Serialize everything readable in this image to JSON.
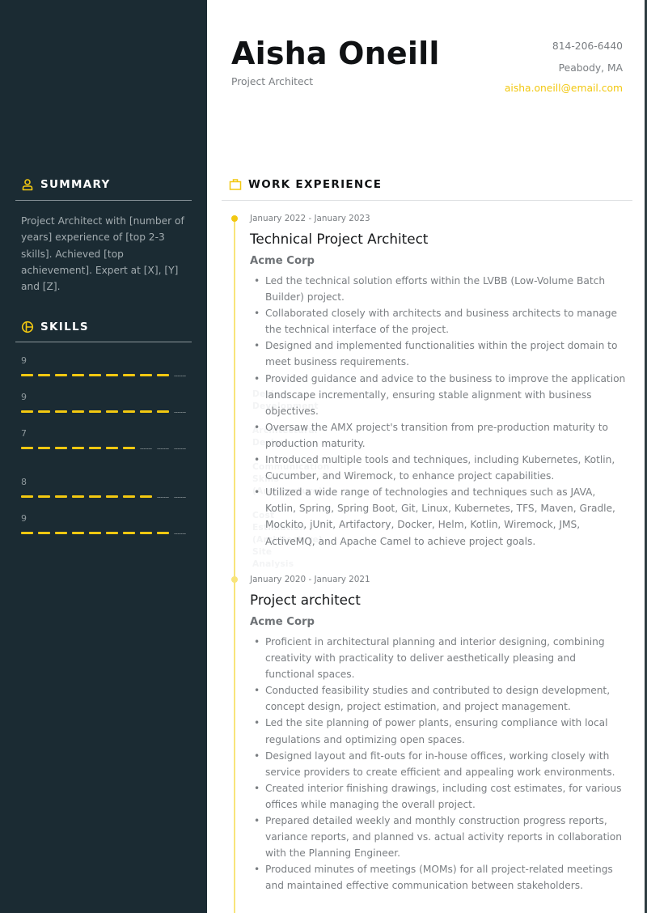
{
  "header": {
    "name": "Aisha Oneill",
    "title": "Project Architect",
    "phone": "814-206-6440",
    "location": "Peabody, MA",
    "email": "aisha.oneill@email.com"
  },
  "colors": {
    "sidebar_bg": "#1b2b33",
    "accent": "#f2c811",
    "accent_light": "#f8e47a"
  },
  "sidebar": {
    "summary": {
      "icon": "person-icon",
      "title": "SUMMARY",
      "text": "Project Architect with [number of years] experience of [top 2-3 skills]. Achieved [top achievement]. Expert at [X], [Y] and [Z]."
    },
    "skills": {
      "icon": "pie-chart-icon",
      "title": "SKILLS",
      "max_score": 10,
      "items": [
        {
          "name": "Design Development",
          "score": 9
        },
        {
          "name": "Architectural Design",
          "score": 9
        },
        {
          "name": "Communication Skills (Architecture)",
          "score": 7
        },
        {
          "name": "Cost Estimation (Architecture)",
          "score": 8
        },
        {
          "name": "Site Analysis",
          "score": 9
        }
      ]
    }
  },
  "experience": {
    "icon": "briefcase-icon",
    "title": "WORK EXPERIENCE",
    "jobs": [
      {
        "dates": "January 2022 - January 2023",
        "role": "Technical Project Architect",
        "company": "Acme Corp",
        "bullets": [
          "Led the technical solution efforts within the LVBB (Low-Volume Batch Builder) project.",
          "Collaborated closely with architects and business architects to manage the technical interface of the project.",
          "Designed and implemented functionalities within the project domain to meet business requirements.",
          "Provided guidance and advice to the business to improve the application landscape incrementally, ensuring stable alignment with business objectives.",
          "Oversaw the AMX project's transition from pre-production maturity to production maturity.",
          "Introduced multiple tools and techniques, including Kubernetes, Kotlin, Cucumber, and Wiremock, to enhance project capabilities.",
          "Utilized a wide range of technologies and techniques such as JAVA, Kotlin, Spring, Spring Boot, Git, Linux, Kubernetes, TFS, Maven, Gradle, Mockito, jUnit, Artifactory, Docker, Helm, Kotlin, Wiremock, JMS, ActiveMQ, and Apache Camel to achieve project goals."
        ]
      },
      {
        "dates": "January 2020 - January 2021",
        "role": "Project architect",
        "company": "Acme Corp",
        "bullets": [
          "Proficient in architectural planning and interior designing, combining creativity with practicality to deliver aesthetically pleasing and functional spaces.",
          "Conducted feasibility studies and contributed to design development, concept design, project estimation, and project management.",
          "Led the site planning of power plants, ensuring compliance with local regulations and optimizing open spaces.",
          "Designed layout and fit-outs for in-house offices, working closely with service providers to create efficient and appealing work environments.",
          "Created interior finishing drawings, including cost estimates, for various offices while managing the overall project.",
          "Prepared detailed weekly and monthly construction progress reports, variance reports, and planned vs. actual activity reports in collaboration with the Planning Engineer.",
          "Produced minutes of meetings (MOMs) for all project-related meetings and maintained effective communication between stakeholders."
        ]
      }
    ]
  }
}
